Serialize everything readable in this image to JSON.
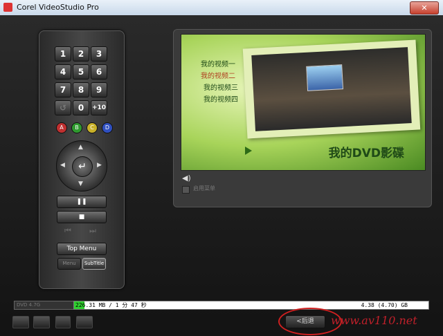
{
  "window": {
    "title": "Corel VideoStudio Pro",
    "close_glyph": "✕"
  },
  "remote": {
    "keys": [
      "1",
      "2",
      "3",
      "4",
      "5",
      "6",
      "7",
      "8",
      "9",
      "↺",
      "0",
      "+10"
    ],
    "color_buttons": [
      {
        "label": "A",
        "color": "#c03030"
      },
      {
        "label": "B",
        "color": "#2f9a2f"
      },
      {
        "label": "C",
        "color": "#c9b12a"
      },
      {
        "label": "D",
        "color": "#3050c0"
      }
    ],
    "enter_glyph": "↵",
    "pause_glyph": "❚❚",
    "stop_glyph": "■",
    "prev_glyph": "⏮",
    "next_glyph": "⏭",
    "top_menu_label": "Top Menu",
    "menu_label": "Menu",
    "subtitle_label": "SubTitle"
  },
  "preview": {
    "menu_items": [
      "我的视频一",
      "我的视频二",
      "我的视频三",
      "我的视频四"
    ],
    "dvd_title": "我的DVD影碟",
    "speaker_glyph": "◀)",
    "checkbox_label": "启用菜单"
  },
  "capacity": {
    "disc_type": "DVD 4.7G",
    "used_text": "226.31 MB / 1 分 47 秒",
    "total_text": "4.38 (4.70) GB",
    "used_fraction": 0.03
  },
  "footer": {
    "back_label": "<后退",
    "watermark": "www.av110.net"
  },
  "colors": {
    "accent_green": "#2fd02f",
    "watermark_red": "#c0202a"
  }
}
